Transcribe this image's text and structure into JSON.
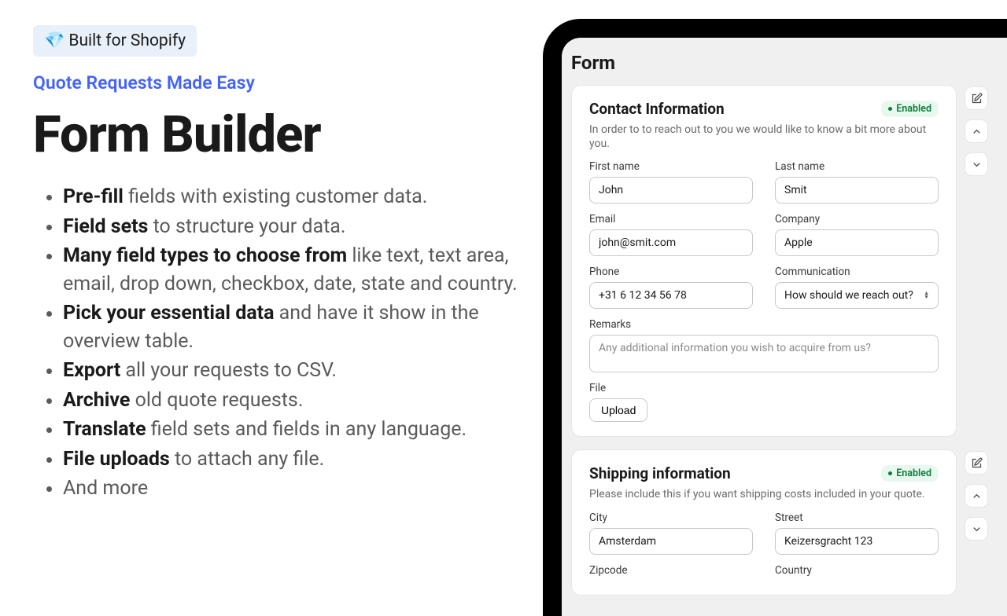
{
  "badge": "💎 Built for Shopify",
  "subtitle": "Quote Requests Made Easy",
  "title": "Form Builder",
  "features": [
    {
      "bold": "Pre-fill",
      "rest": " fields with existing customer data."
    },
    {
      "bold": "Field sets",
      "rest": " to structure your data."
    },
    {
      "bold": "Many field types to choose from",
      "rest": " like text, text area, email, drop down, checkbox, date, state and country."
    },
    {
      "bold": "Pick your essential data",
      "rest": " and have it show in the overview table."
    },
    {
      "bold": "Export",
      "rest": " all your requests to CSV."
    },
    {
      "bold": "Archive",
      "rest": " old quote requests."
    },
    {
      "bold": "Translate",
      "rest": " field sets and fields in any language."
    },
    {
      "bold": "File uploads",
      "rest": " to attach any file."
    },
    {
      "bold": "",
      "rest": "And more"
    }
  ],
  "form_title": "Form",
  "enabled": "Enabled",
  "contact": {
    "title": "Contact Information",
    "desc": "In order to to reach out to you we would like to know a bit more about you.",
    "first_label": "First name",
    "first_val": "John",
    "last_label": "Last name",
    "last_val": "Smit",
    "email_label": "Email",
    "email_val": "john@smit.com",
    "company_label": "Company",
    "company_val": "Apple",
    "phone_label": "Phone",
    "phone_val": "+31 6 12 34 56 78",
    "comm_label": "Communication",
    "comm_val": "How should we reach out?",
    "remarks_label": "Remarks",
    "remarks_ph": "Any additional information you wish to acquire from us?",
    "file_label": "File",
    "upload": "Upload"
  },
  "shipping": {
    "title": "Shipping information",
    "desc": "Please include this if you want shipping costs included in your quote.",
    "city_label": "City",
    "city_val": "Amsterdam",
    "street_label": "Street",
    "street_val": "Keizersgracht 123",
    "zip_label": "Zipcode",
    "country_label": "Country"
  }
}
